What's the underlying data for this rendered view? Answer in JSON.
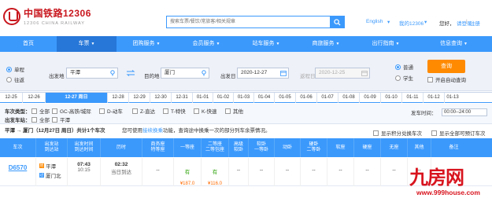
{
  "header": {
    "logo_cn": "中国铁路12306",
    "logo_en": "12306 CHINA RAILWAY",
    "search_placeholder": "搜索车票/餐饮/常旅客/相关规章",
    "lang": "English",
    "my12306": "我的12306",
    "hello": "您好，",
    "login": "请登录",
    "sep": "|",
    "register": "注册"
  },
  "nav": [
    {
      "label": "首页",
      "chev": ""
    },
    {
      "label": "车票",
      "chev": "▼",
      "active": true
    },
    {
      "label": "团购服务",
      "chev": "▼"
    },
    {
      "label": "会员服务",
      "chev": "▼"
    },
    {
      "label": "站车服务",
      "chev": "▼"
    },
    {
      "label": "商旅服务",
      "chev": "▼"
    },
    {
      "label": "出行指南",
      "chev": "▼"
    },
    {
      "label": "信息查询",
      "chev": "▼"
    }
  ],
  "query": {
    "trip_single": "单程",
    "trip_round": "往返",
    "from_label": "出发地",
    "from_value": "平潭",
    "to_label": "目的地",
    "to_value": "厦门",
    "date_label": "出发日",
    "date_value": "2020-12-27",
    "return_label": "返程日",
    "return_value": "2020-12-25",
    "type_normal": "普通",
    "type_student": "学生",
    "query_button": "查询",
    "auto_query": "开启自动查询"
  },
  "dates": [
    "12-25",
    "12-26",
    "12-27 周日",
    "12-28",
    "12-29",
    "12-30",
    "12-31",
    "01-01",
    "01-02",
    "01-03",
    "01-04",
    "01-05",
    "01-06",
    "01-07",
    "01-08",
    "01-09",
    "01-10",
    "01-11",
    "01-12",
    "01-13"
  ],
  "filters": {
    "train_type_label": "车次类型：",
    "all": "全部",
    "types": [
      "GC-高铁/城际",
      "D-动车",
      "Z-直达",
      "T-特快",
      "K-快速",
      "其他"
    ],
    "station_label": "出发车站：",
    "station": "平潭",
    "time_label": "发车时间：",
    "time_value": "00:00--24:00"
  },
  "summary": {
    "route": "平潭 → 厦门（12月27日 周日）共计1个车次",
    "tip_pre": "您可使用",
    "tip_link": "接续换乘",
    "tip_post": "功能，查询途中换乘一次的部分列车余票情况。",
    "show_transfer": "显示积分兑换车次",
    "show_all": "显示全部可预订车次"
  },
  "table": {
    "headers": [
      "车次",
      "出发站\n到达站",
      "出发时间\n到达时间",
      "历时",
      "商务座\n特等座",
      "一等座",
      "二等座\n二等包座",
      "高级\n软卧",
      "软卧\n一等卧",
      "动卧",
      "硬卧\n二等卧",
      "软座",
      "硬座",
      "无座",
      "其他",
      "备注"
    ],
    "row": {
      "train_no": "D6570",
      "from_tag": "始",
      "from": "平潭",
      "to_tag": "过",
      "to": "厦门北",
      "dep": "07:43",
      "arr": "10:15",
      "duration": "02:32",
      "duration_note": "当日到达",
      "first": "有",
      "first_price": "¥187.0",
      "second": "有",
      "second_price": "¥116.0",
      "dash": "--"
    }
  },
  "watermark": {
    "text": "九房网",
    "url": "www.999house.com"
  }
}
